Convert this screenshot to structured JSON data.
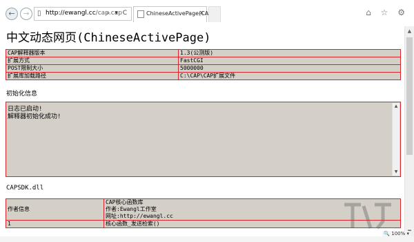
{
  "browser": {
    "address_host": "http://ewangl.cc",
    "address_path": "/cap.cap",
    "address_actions": "⌕ ▾ C",
    "tab_title": "ChineseActivePage(CAP)",
    "tab_close": "×",
    "tools": "⌂ ☆ ⚙",
    "zoom": "🔍 100% ▾"
  },
  "page": {
    "title": "中文动态网页(ChineseActivePage)",
    "info_rows": [
      {
        "key": "CAP解释器版本",
        "value": "1.3(公测版)"
      },
      {
        "key": "扩展方式",
        "value": "FastCGI"
      },
      {
        "key": "POST限制大小",
        "value": "5000000"
      },
      {
        "key": "扩展库加载路径",
        "value": "C:\\CAP\\CAP扩展文件"
      }
    ],
    "init_label": "初始化信息",
    "log_lines": [
      "日志已启动!",
      "解释器初始化成功!"
    ],
    "sdk_label": "CAPSDK.dll",
    "modules": {
      "author_key": "作者信息",
      "author_lines": [
        "CAP核心函数库",
        "作者:Ewangl工作室",
        "网址:http://ewangl.cc"
      ],
      "row2_key": "1",
      "row2_value": "核心函数_发送检索()"
    }
  },
  "colors": {
    "cell_border": "#d9232d",
    "cell_background": "#d4d0c8"
  }
}
